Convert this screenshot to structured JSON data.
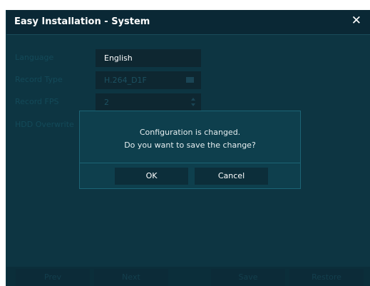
{
  "window": {
    "title": "Easy Installation - System",
    "close_glyph": "✕"
  },
  "form": {
    "rows": [
      {
        "label": "Language",
        "value": "English"
      },
      {
        "label": "Record Type",
        "value": "H.264_D1F"
      },
      {
        "label": "Record FPS",
        "value": "2"
      },
      {
        "label": "HDD Overwrite",
        "value": ""
      }
    ]
  },
  "footer": {
    "prev_label": "Prev",
    "next_label": "Next",
    "save_label": "Save",
    "restore_label": "Restore"
  },
  "dialog": {
    "line1": "Configuration is changed.",
    "line2": "Do you want to save the change?",
    "ok_label": "OK",
    "cancel_label": "Cancel"
  },
  "colors": {
    "window_bg": "#0b2e3a",
    "dialog_bg": "#0e3f4d",
    "dialog_border": "#1c6475",
    "text": "#ffffff"
  }
}
